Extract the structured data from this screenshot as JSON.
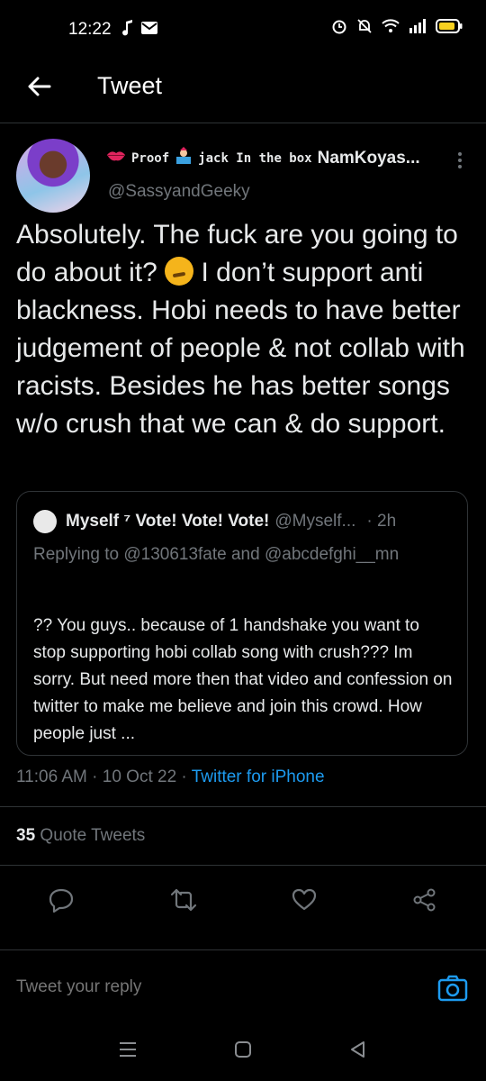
{
  "status_bar": {
    "time": "12:22"
  },
  "header": {
    "title": "Tweet"
  },
  "tweet": {
    "author_display_parts": [
      "Proof",
      "jack In the box",
      "NamKoyas..."
    ],
    "handle": "@SassyandGeeky",
    "text_part1": "Absolutely. The fuck are you going to do about it?",
    "text_part2": "I don’t support anti blackness. Hobi needs to have better judgement of people & not collab with racists. Besides he has better songs w/o crush that we can & do support.",
    "timestamp": "11:06 AM · 10 Oct 22 ·",
    "source": "Twitter for iPhone",
    "quote_tweets_count": "35",
    "quote_tweets_label": "Quote Tweets"
  },
  "quoted": {
    "name": "Myself ⁷ Vote! Vote! Vote!",
    "handle": "@Myself...",
    "time": "· 2h",
    "replying_to": "Replying to @130613fate and @abcdefghi__mn",
    "text": "?? You guys.. because of 1 handshake you want to stop supporting hobi collab song with crush??? Im sorry. But need more then that video and confession on twitter to make me believe and join this crowd. How people just ..."
  },
  "reply": {
    "placeholder": "Tweet your reply"
  },
  "icons": [
    "music-note-icon",
    "mail-icon",
    "alarm-icon",
    "mute-icon",
    "wifi-icon",
    "signal-icon",
    "battery-icon",
    "back-arrow-icon",
    "more-icon",
    "reply-icon",
    "retweet-icon",
    "like-icon",
    "share-icon",
    "camera-icon",
    "menu-icon",
    "home-icon",
    "back-icon"
  ],
  "colors": {
    "accent": "#1d9bf0",
    "background": "#000000",
    "muted": "#71767b",
    "text": "#e7e9ea"
  }
}
